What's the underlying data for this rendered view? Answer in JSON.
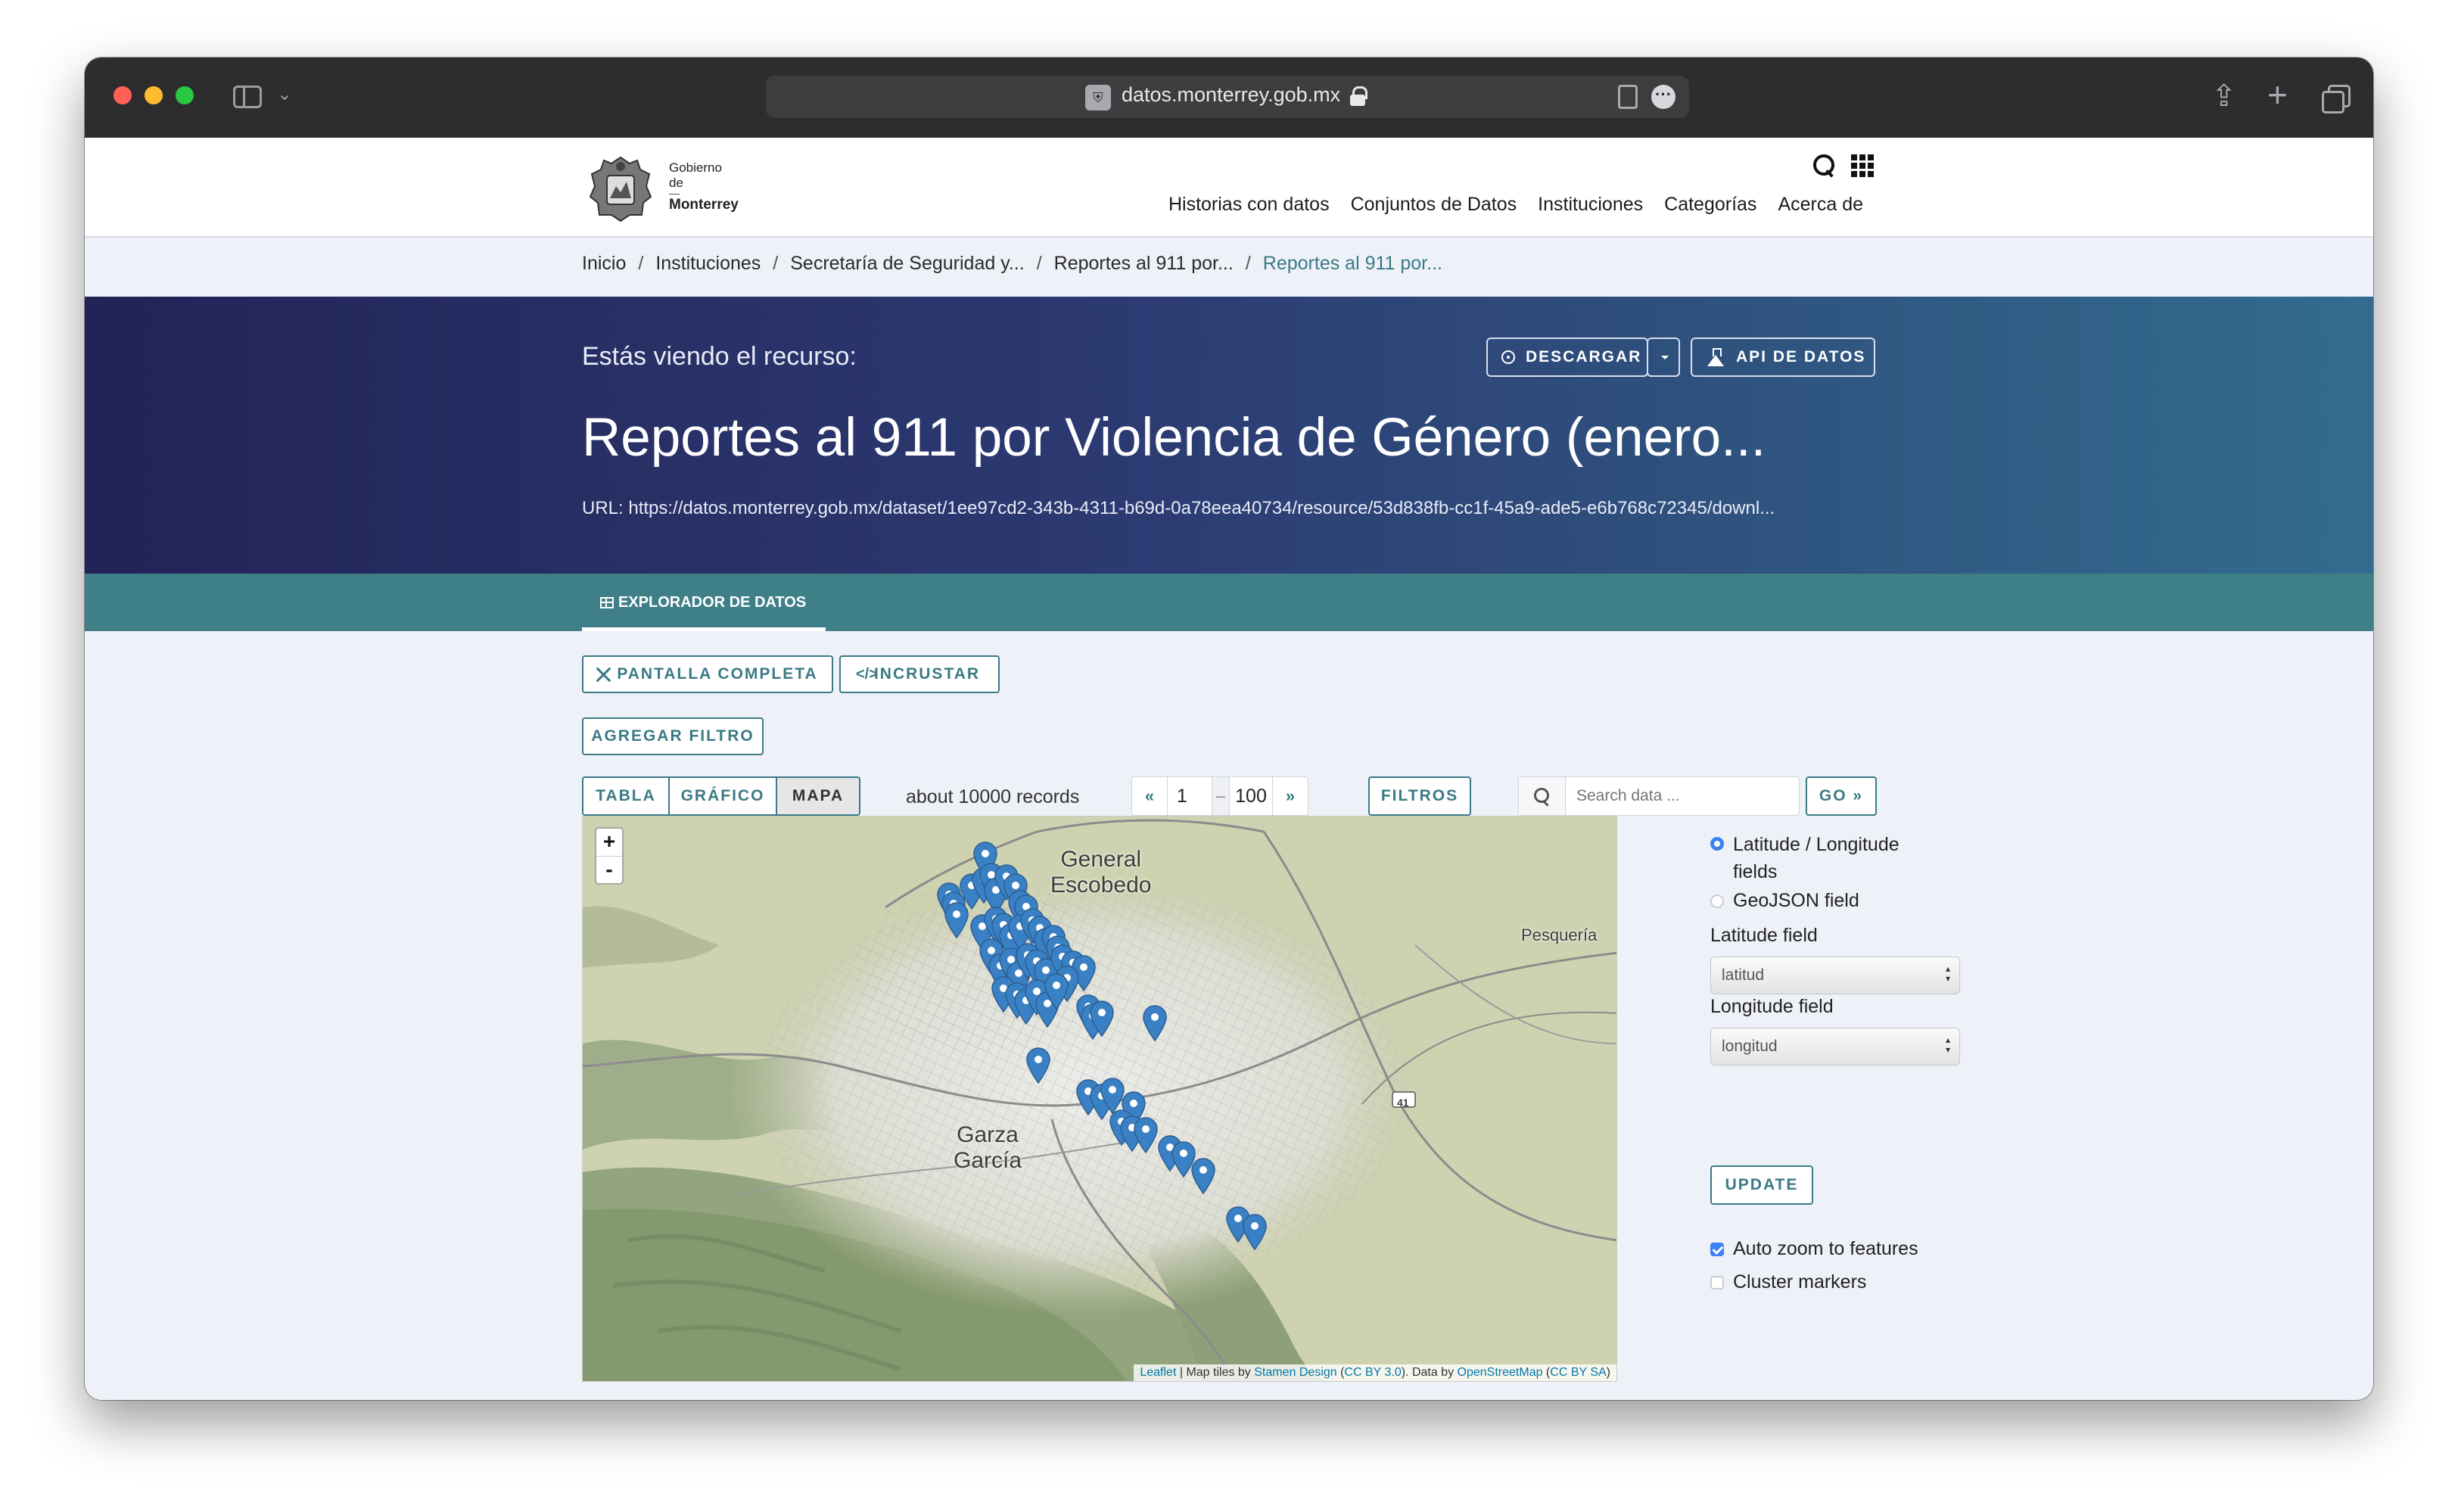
{
  "browser": {
    "url": "datos.monterrey.gob.mx"
  },
  "site": {
    "logo": {
      "line1": "Gobierno",
      "line2": "de",
      "line3": "Monterrey"
    },
    "nav": [
      "Historias con datos",
      "Conjuntos de Datos",
      "Instituciones",
      "Categorías",
      "Acerca de"
    ]
  },
  "breadcrumb": [
    "Inicio",
    "Instituciones",
    "Secretaría de Seguridad y...",
    "Reportes al 911 por...",
    "Reportes al 911 por..."
  ],
  "hero": {
    "kicker": "Estás viendo el recurso:",
    "title": "Reportes al 911 por Violencia de Género (enero...",
    "url": "URL: https://datos.monterrey.gob.mx/dataset/1ee97cd2-343b-4311-b69d-0a78eea40734/resource/53d838fb-cc1f-45a9-ade5-e6b768c72345/downl...",
    "download_label": "DESCARGAR",
    "api_label": "API DE DATOS"
  },
  "tabs": {
    "explorer_label": "EXPLORADOR DE DATOS"
  },
  "toolbar": {
    "fullscreen_label": "PANTALLA COMPLETA",
    "embed_label": "INCRUSTAR",
    "add_filter_label": "AGREGAR FILTRO",
    "views": [
      "TABLA",
      "GRÁFICO",
      "MAPA"
    ],
    "active_view": "MAPA",
    "records_text": "about 10000 records",
    "pager": {
      "prev": "«",
      "from": "1",
      "to": "100",
      "next": "»"
    },
    "filters_label": "FILTROS",
    "search_placeholder": "Search data ...",
    "go_label": "GO »"
  },
  "map": {
    "zoom_in": "+",
    "zoom_out": "-",
    "labels": {
      "escobedo_1": "General",
      "escobedo_2": "Escobedo",
      "pesqueria": "Pesquería",
      "garza_1": "Garza",
      "garza_2": "García",
      "highway": "41"
    },
    "attribution": {
      "leaflet": "Leaflet",
      "sep1": " | Map tiles by ",
      "stamen": "Stamen Design",
      "lp1": " (",
      "cc1": "CC BY 3.0",
      "mid": "). Data by ",
      "osm": "OpenStreetMap",
      "lp2": " (",
      "cc2": "CC BY SA",
      "rp2": ")"
    },
    "marker_color": "#3a80c4",
    "marker_count": 56
  },
  "panel": {
    "radio_latlon_1": "Latitude / Longitude",
    "radio_latlon_2": "fields",
    "radio_geojson": "GeoJSON field",
    "latitude_label": "Latitude field",
    "latitude_value": "latitud",
    "longitude_label": "Longitude field",
    "longitude_value": "longitud",
    "update_label": "UPDATE",
    "auto_zoom_label": "Auto zoom to features",
    "auto_zoom_checked": true,
    "cluster_label": "Cluster markers",
    "cluster_checked": false
  },
  "colors": {
    "teal": "#3b7a86",
    "hero_start": "#222357",
    "hero_end": "#336c8f",
    "marker": "#3a80c4"
  }
}
